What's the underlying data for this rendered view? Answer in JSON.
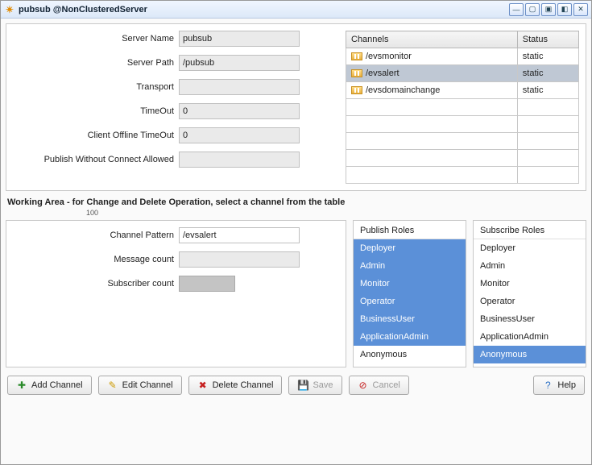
{
  "window": {
    "title": "pubsub @NonClusteredServer"
  },
  "form": {
    "server_name_label": "Server Name",
    "server_name": "pubsub",
    "server_path_label": "Server Path",
    "server_path": "/pubsub",
    "transport_label": "Transport",
    "transport": "",
    "timeout_label": "TimeOut",
    "timeout": "0",
    "client_offline_label": "Client Offline TimeOut",
    "client_offline": "0",
    "pwca_label": "Publish Without Connect Allowed",
    "pwca": ""
  },
  "channels_table": {
    "col_channels": "Channels",
    "col_status": "Status",
    "rows": [
      {
        "name": "/evsmonitor",
        "status": "static"
      },
      {
        "name": "/evsalert",
        "status": "static"
      },
      {
        "name": "/evsdomainchange",
        "status": "static"
      }
    ],
    "selected_index": 1
  },
  "working": {
    "heading": "Working Area - for Change and Delete Operation, select a channel from the table",
    "sub": "100",
    "channel_pattern_label": "Channel Pattern",
    "channel_pattern": "/evsalert",
    "message_count_label": "Message count",
    "message_count": "",
    "subscriber_count_label": "Subscriber count",
    "subscriber_count": ""
  },
  "publish_roles": {
    "title": "Publish Roles",
    "items": [
      {
        "label": "Deployer",
        "selected": true
      },
      {
        "label": "Admin",
        "selected": true
      },
      {
        "label": "Monitor",
        "selected": true
      },
      {
        "label": "Operator",
        "selected": true
      },
      {
        "label": "BusinessUser",
        "selected": true
      },
      {
        "label": "ApplicationAdmin",
        "selected": true
      },
      {
        "label": "Anonymous",
        "selected": false
      }
    ]
  },
  "subscribe_roles": {
    "title": "Subscribe Roles",
    "items": [
      {
        "label": "Deployer",
        "selected": false
      },
      {
        "label": "Admin",
        "selected": false
      },
      {
        "label": "Monitor",
        "selected": false
      },
      {
        "label": "Operator",
        "selected": false
      },
      {
        "label": "BusinessUser",
        "selected": false
      },
      {
        "label": "ApplicationAdmin",
        "selected": false
      },
      {
        "label": "Anonymous",
        "selected": true
      }
    ]
  },
  "toolbar": {
    "add": "Add Channel",
    "edit": "Edit Channel",
    "delete": "Delete Channel",
    "save": "Save",
    "cancel": "Cancel",
    "help": "Help"
  }
}
